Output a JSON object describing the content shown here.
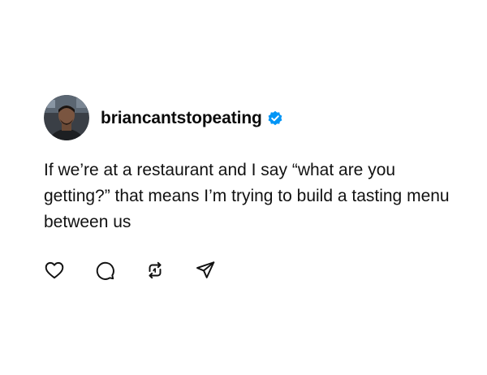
{
  "post": {
    "username": "briancantstopeating",
    "verified": true,
    "text": "If we’re at a restaurant and I say “what are you getting?” that means I’m trying to build a tasting menu between us"
  },
  "actions": {
    "like_icon": "heart-icon",
    "comment_icon": "comment-icon",
    "repost_icon": "repost-icon",
    "share_icon": "send-icon"
  },
  "colors": {
    "verified_badge": "#0095f6",
    "text": "#111111",
    "background": "#ffffff"
  }
}
